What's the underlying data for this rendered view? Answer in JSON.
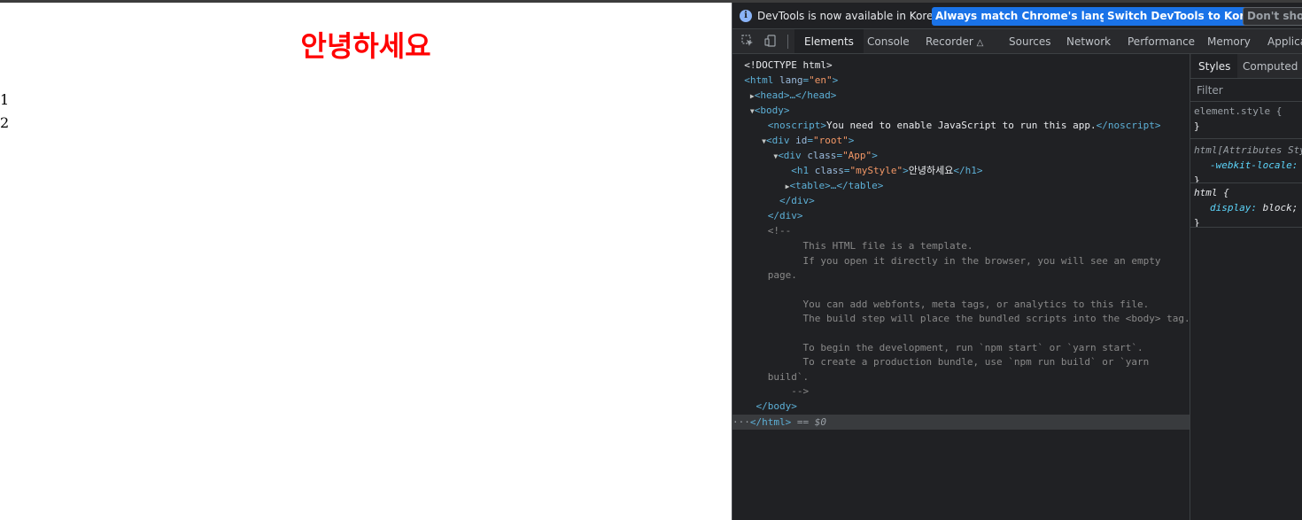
{
  "page": {
    "heading": "안녕하세요",
    "table_rows": [
      "1",
      "2"
    ]
  },
  "devtools": {
    "infobar": {
      "text": "DevTools is now available in Korean!",
      "btn_match": "Always match Chrome's language",
      "btn_switch": "Switch DevTools to Korean",
      "btn_dont_show": "Don't show"
    },
    "tabs": [
      "Elements",
      "Console",
      "Recorder",
      "Sources",
      "Network",
      "Performance",
      "Memory",
      "Applica"
    ],
    "dom": {
      "doctype": "<!DOCTYPE html>",
      "html_open": "<html",
      "lang_attr": "lang",
      "lang_val": "\"en\"",
      "head": "<head>…</head>",
      "body_open": "<body>",
      "noscript_open": "<noscript>",
      "noscript_text": "You need to enable JavaScript to run this app.",
      "noscript_close": "</noscript>",
      "div_root_open": "<div",
      "id_attr": "id",
      "id_val": "\"root\"",
      "div_app_open": "<div",
      "class_attr": "class",
      "class_app_val": "\"App\"",
      "h1_open": "<h1",
      "h1_class_val": "\"myStyle\"",
      "h1_text": "안녕하세요",
      "h1_close": "</h1>",
      "table": "<table>…</table>",
      "div_close": "</div>",
      "comment_open": "<!--",
      "comment_lines": [
        "This HTML file is a template.",
        "If you open it directly in the browser, you will see an empty",
        "page.",
        "You can add webfonts, meta tags, or analytics to this file.",
        "The build step will place the bundled scripts into the <body> tag.",
        "To begin the development, run `npm start` or `yarn start`.",
        "To create a production bundle, use `npm run build` or `yarn",
        "build`."
      ],
      "comment_close": "-->",
      "body_close": "</body>",
      "html_close": "</html>",
      "selected_marker": "== $0",
      "ellipsis": "···"
    },
    "styles": {
      "tabs": [
        "Styles",
        "Computed"
      ],
      "filter_placeholder": "Filter",
      "element_style": "element.style {",
      "close_brace": "}",
      "attr_rule": "html[Attributes Sty",
      "webkit_prop": "-webkit-locale:",
      "html_rule": "html {",
      "display_prop": "display:",
      "display_val": "block;"
    }
  }
}
